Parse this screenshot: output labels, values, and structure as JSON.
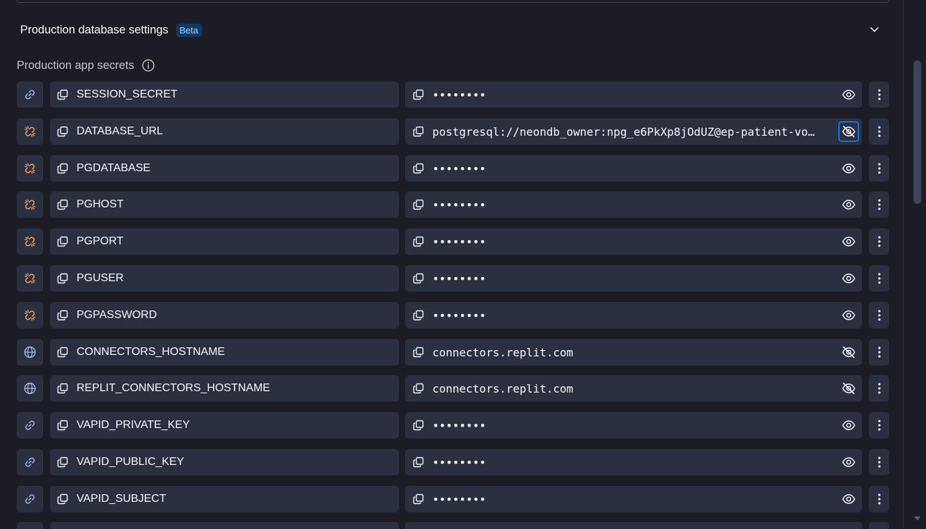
{
  "settings": {
    "title": "Production database settings",
    "badge": "Beta"
  },
  "secrets_section": {
    "label": "Production app secrets"
  },
  "secrets": [
    {
      "type_icon": "link-icon",
      "key": "SESSION_SECRET",
      "value": "••••••••",
      "visibility_icon": "eye-icon"
    },
    {
      "type_icon": "broken-link-icon",
      "key": "DATABASE_URL",
      "value": "postgresql://neondb_owner:npg_e6PkXp8jOdUZ@ep-patient-vo…",
      "visibility_icon": "eye-off-icon"
    },
    {
      "type_icon": "broken-link-icon",
      "key": "PGDATABASE",
      "value": "••••••••",
      "visibility_icon": "eye-icon"
    },
    {
      "type_icon": "broken-link-icon",
      "key": "PGHOST",
      "value": "••••••••",
      "visibility_icon": "eye-icon"
    },
    {
      "type_icon": "broken-link-icon",
      "key": "PGPORT",
      "value": "••••••••",
      "visibility_icon": "eye-icon"
    },
    {
      "type_icon": "broken-link-icon",
      "key": "PGUSER",
      "value": "••••••••",
      "visibility_icon": "eye-icon"
    },
    {
      "type_icon": "broken-link-icon",
      "key": "PGPASSWORD",
      "value": "••••••••",
      "visibility_icon": "eye-icon"
    },
    {
      "type_icon": "globe-icon",
      "key": "CONNECTORS_HOSTNAME",
      "value": "connectors.replit.com",
      "visibility_icon": "eye-off-icon"
    },
    {
      "type_icon": "globe-icon",
      "key": "REPLIT_CONNECTORS_HOSTNAME",
      "value": "connectors.replit.com",
      "visibility_icon": "eye-off-icon"
    },
    {
      "type_icon": "link-icon",
      "key": "VAPID_PRIVATE_KEY",
      "value": "••••••••",
      "visibility_icon": "eye-icon"
    },
    {
      "type_icon": "link-icon",
      "key": "VAPID_PUBLIC_KEY",
      "value": "••••••••",
      "visibility_icon": "eye-icon"
    },
    {
      "type_icon": "link-icon",
      "key": "VAPID_SUBJECT",
      "value": "••••••••",
      "visibility_icon": "eye-icon"
    }
  ],
  "colors": {
    "background": "#1c1d24",
    "cell": "#2b3040",
    "link_icon": "#a7b8e8",
    "broken_link_icon": "#f6a46b",
    "focus_ring": "#0079f2",
    "badge_bg": "#0e3a6b"
  }
}
